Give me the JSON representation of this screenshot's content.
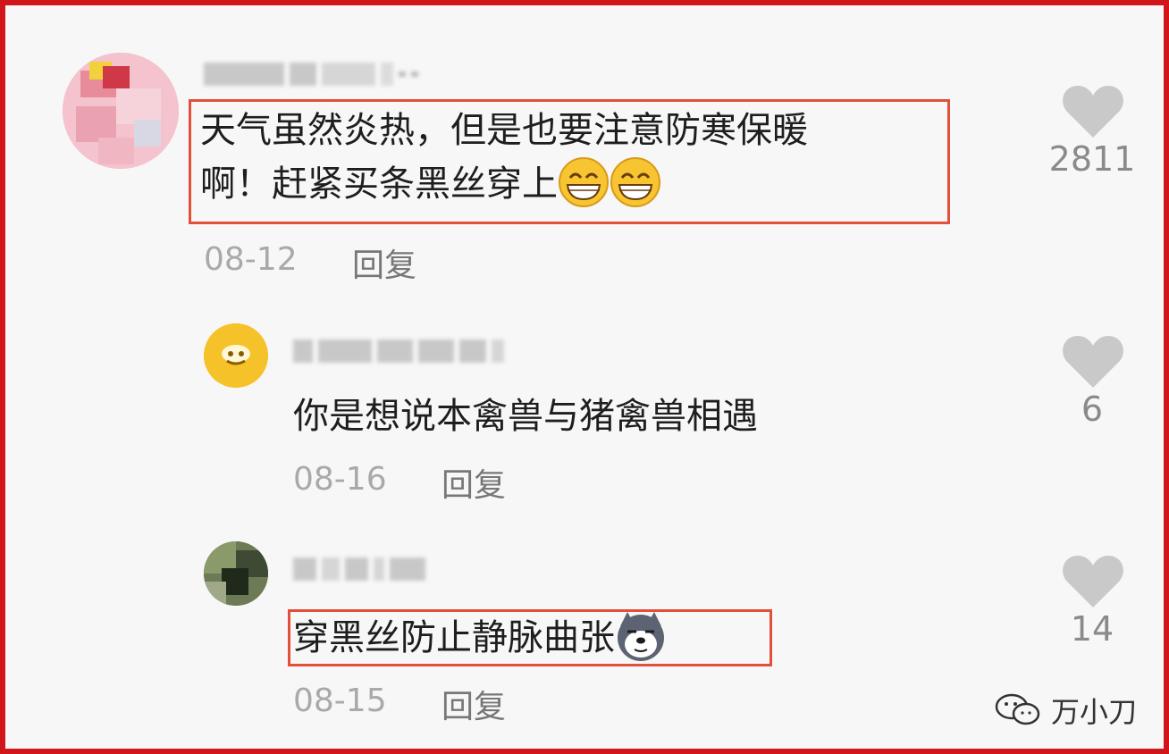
{
  "comments": [
    {
      "text_line1": "天气虽然炎热，但是也要注意防寒保暖",
      "text_line2": "啊！赶紧买条黑丝穿上",
      "date": "08-12",
      "reply_label": "回复",
      "likes": "2811",
      "emojis": [
        "grin-emoji",
        "grin-emoji"
      ]
    },
    {
      "text": "你是想说本禽兽与猪禽兽相遇",
      "date": "08-16",
      "reply_label": "回复",
      "likes": "6"
    },
    {
      "text": "穿黑丝防止静脉曲张",
      "date": "08-15",
      "reply_label": "回复",
      "likes": "14",
      "emojis": [
        "husky-emoji"
      ]
    }
  ],
  "watermark": {
    "text": "万小刀",
    "icon": "wechat-icon"
  },
  "colors": {
    "frame": "#d0161b",
    "highlight": "#e2503a",
    "heart": "#c9c9c9"
  }
}
